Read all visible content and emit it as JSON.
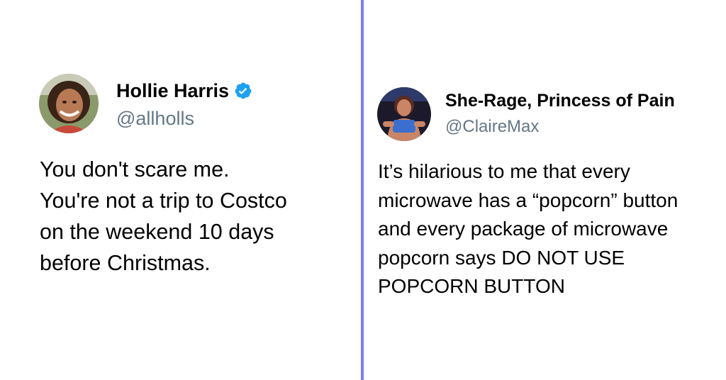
{
  "colors": {
    "divider": "#7b7ff0",
    "verified_badge": "#1da1f2",
    "handle_text": "#657786",
    "body_text": "#000000"
  },
  "tweets": [
    {
      "display_name": "Hollie Harris",
      "verified": true,
      "verified_icon": "verified-badge-icon",
      "handle": "@allholls",
      "text": "You don't scare me.\nYou're not a trip to Costco\non the weekend 10 days\nbefore Christmas."
    },
    {
      "display_name": "She-Rage, Princess of Pain",
      "verified": false,
      "handle": "@ClaireMax",
      "text": "It’s hilarious to me that every\nmicrowave has a “popcorn” button\nand every package of microwave\npopcorn says DO NOT USE\nPOPCORN BUTTON"
    }
  ]
}
